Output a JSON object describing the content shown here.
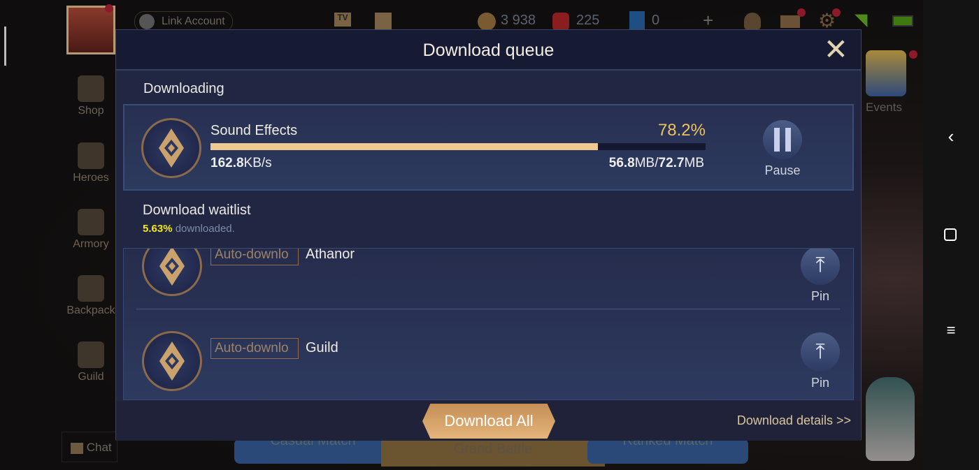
{
  "background": {
    "link_account": "Link Account",
    "currency_gold": "3 938",
    "currency_gems": "225",
    "currency_tickets": "0",
    "sidebar": [
      {
        "label": "Shop"
      },
      {
        "label": "Heroes"
      },
      {
        "label": "Armory"
      },
      {
        "label": "Backpack"
      },
      {
        "label": "Guild"
      }
    ],
    "chat": "Chat",
    "events": "Events",
    "modes": [
      "Casual Match",
      "Grand Battle",
      "Ranked Match"
    ]
  },
  "dialog": {
    "title": "Download queue",
    "downloading_title": "Downloading",
    "current": {
      "name": "Sound Effects",
      "percent_label": "78.2%",
      "progress": 0.782,
      "speed_num": "162.8",
      "speed_unit": "KB/s",
      "done_num": "56.8",
      "total_num": "72.7",
      "unit": "MB",
      "sep": "/",
      "pause_label": "Pause"
    },
    "waitlist_title": "Download waitlist",
    "waitlist_percent": "5.63%",
    "waitlist_suffix": "downloaded.",
    "items": [
      {
        "tag": "Auto-downlo",
        "name": "Athanor",
        "pin": "Pin"
      },
      {
        "tag": "Auto-downlo",
        "name": "Guild",
        "pin": "Pin"
      }
    ],
    "download_all": "Download All",
    "download_details": "Download details >>"
  },
  "colors": {
    "accent_gold": "#efc98f",
    "percent_yellow": "#f3e81c",
    "panel": "#212643"
  }
}
